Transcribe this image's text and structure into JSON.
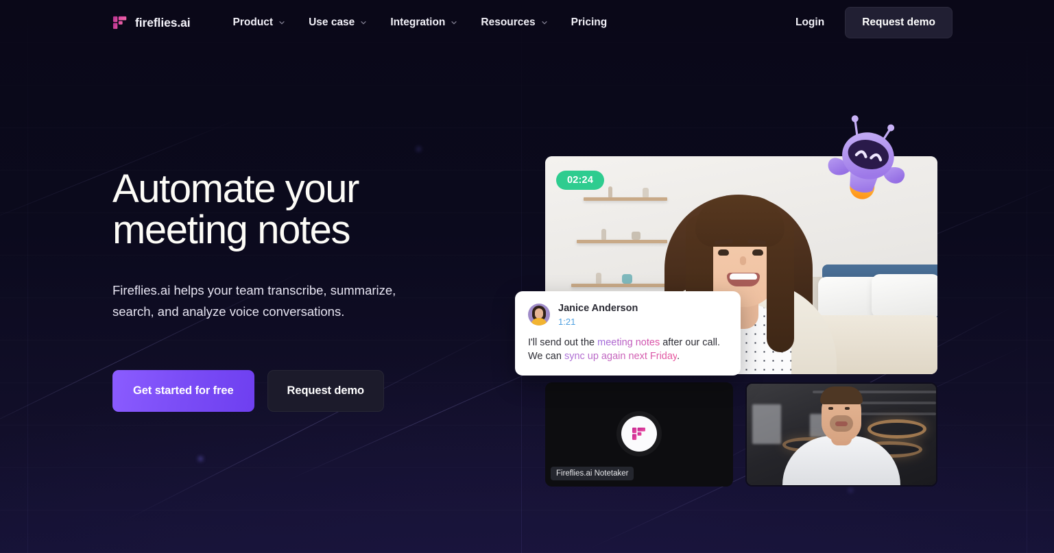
{
  "brand": {
    "name": "fireflies.ai",
    "logo_icon": "fireflies-logo-icon"
  },
  "nav": {
    "links": [
      {
        "label": "Product",
        "has_dropdown": true,
        "icon": "chevron-down-icon"
      },
      {
        "label": "Use case",
        "has_dropdown": true,
        "icon": "chevron-down-icon"
      },
      {
        "label": "Integration",
        "has_dropdown": true,
        "icon": "chevron-down-icon"
      },
      {
        "label": "Resources",
        "has_dropdown": true,
        "icon": "chevron-down-icon"
      },
      {
        "label": "Pricing",
        "has_dropdown": false,
        "icon": ""
      }
    ],
    "login_label": "Login",
    "demo_label": "Request demo"
  },
  "hero": {
    "headline": "Automate your\nmeeting notes",
    "subhead": "Fireflies.ai helps your team transcribe, summarize,\nsearch, and analyze voice conversations.",
    "primary_cta": "Get started for free",
    "secondary_cta": "Request demo"
  },
  "media": {
    "timestamp_badge": "02:24",
    "notetaker_label": "Fireflies.ai Notetaker",
    "tiles": [
      {
        "name": "main-participant-video",
        "alt": "smiling woman on video call in a bedroom"
      },
      {
        "name": "notetaker-tile",
        "alt": "Fireflies.ai Notetaker bot tile"
      },
      {
        "name": "second-participant-video",
        "alt": "man in white shirt in an office"
      }
    ],
    "mascot_icon": "fireflies-robot-mascot-icon"
  },
  "comment": {
    "author": "Janice Anderson",
    "time": "1:21",
    "line1_pre": "I'll send out the ",
    "line1_hl": "meeting notes",
    "line1_post": " after our call.",
    "line2_pre": "We can ",
    "line2_hl": "sync up again next Friday",
    "line2_post": "."
  },
  "colors": {
    "page_bg": "#0a0818",
    "page_bg_bottom": "#151235",
    "brand_pink": "#e8449a",
    "brand_purple": "#7b4df6",
    "accent_green": "#2ecc8f",
    "demo_btn_bg": "#211f33",
    "secondary_btn_bg": "#1c1b2b",
    "comment_card_bg": "#ffffff",
    "comment_time_blue": "#4a9ee0",
    "mascot_purple": "#9b7ce8",
    "mascot_glow_orange": "#ffab2e"
  }
}
